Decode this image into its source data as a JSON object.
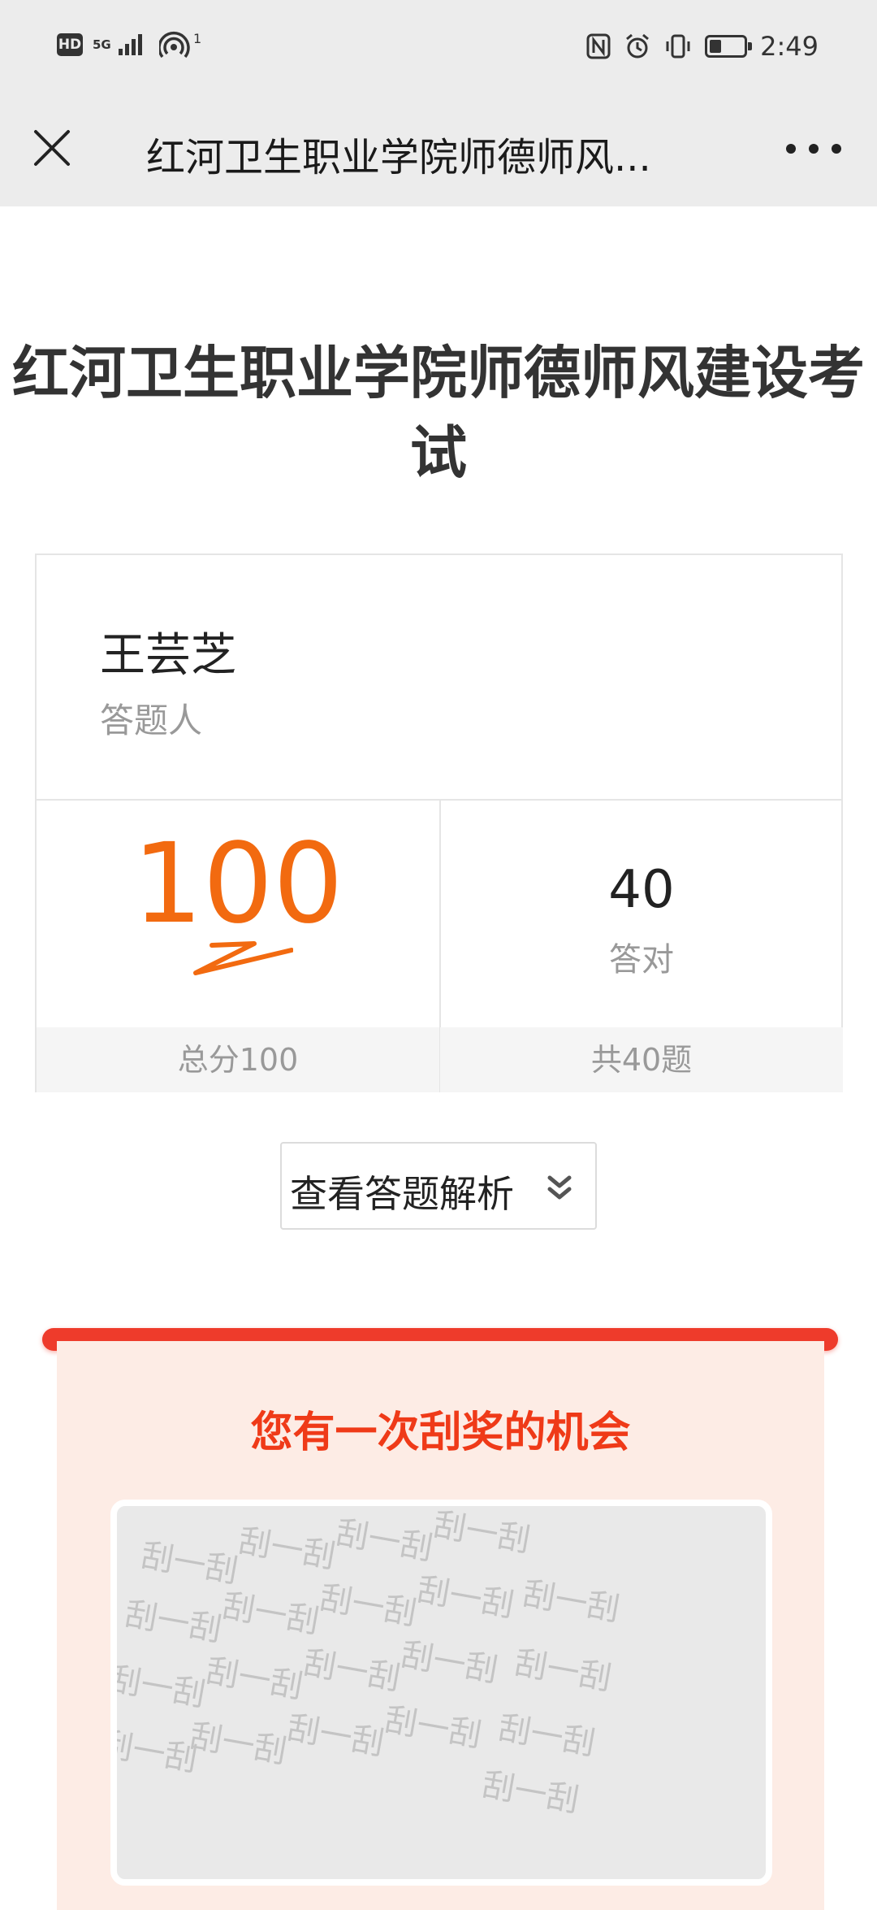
{
  "status_bar": {
    "hd": "HD",
    "network": "5G",
    "hotspot_badge": "1",
    "time": "2:49",
    "battery_level": 0.35
  },
  "nav": {
    "title": "红河卫生职业学院师德师风...",
    "close_icon": "close-icon",
    "more_icon": "more-icon"
  },
  "exam": {
    "title": "红河卫生职业学院师德师风建设考试"
  },
  "result": {
    "name": "王芸芝",
    "role_label": "答题人",
    "score": "100",
    "score_total_label": "总分100",
    "correct_count": "40",
    "correct_label": "答对",
    "total_questions_label": "共40题"
  },
  "analysis_button": {
    "label": "查看答题解析",
    "icon": "double-chevron-down-icon"
  },
  "scratch": {
    "title": "您有一次刮奖的机会",
    "watermark_text": "刮一刮"
  },
  "colors": {
    "accent_orange": "#f26a10",
    "prize_red": "#ef3a18",
    "rod_red": "#ee3b2b",
    "panel_bg": "#fdece5"
  }
}
